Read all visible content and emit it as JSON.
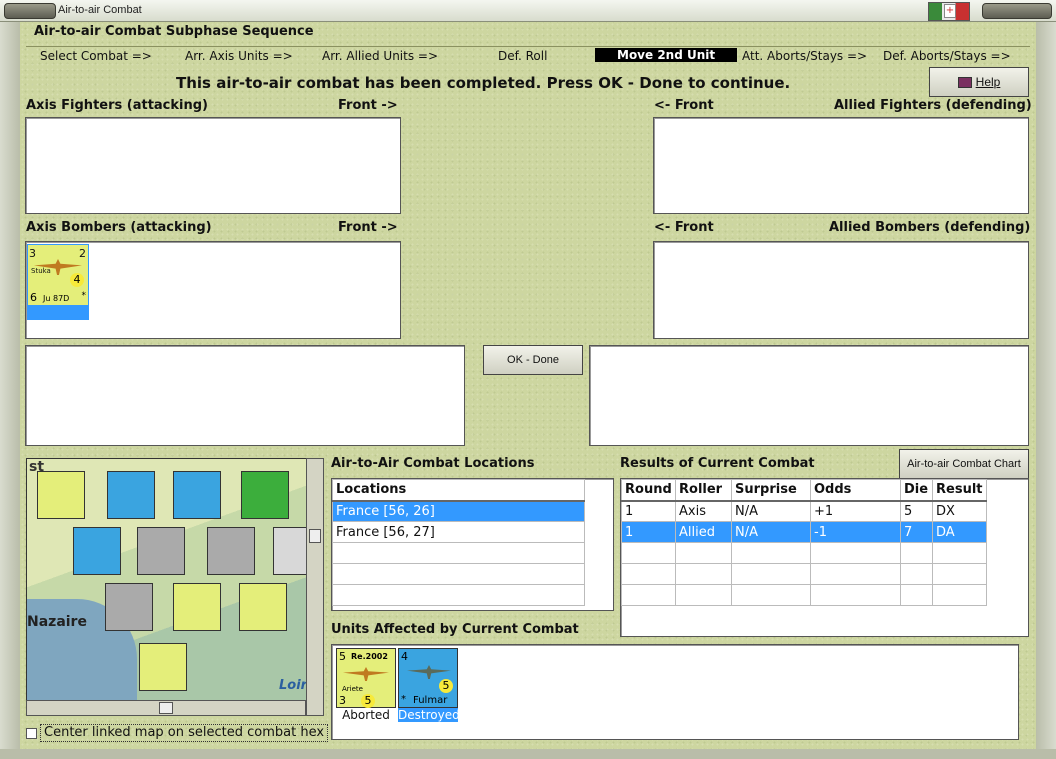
{
  "window": {
    "title": "Air-to-air Combat"
  },
  "subphase": {
    "title": "Air-to-air Combat Subphase Sequence",
    "steps": [
      "Select Combat =>",
      "Arr. Axis Units =>",
      "Arr. Allied Units =>",
      "Def. Roll",
      "Move 2nd Unit",
      "Att. Aborts/Stays =>",
      "Def. Aborts/Stays =>"
    ],
    "active_step": "Move 2nd Unit"
  },
  "message": "This air-to-air combat has been completed.  Press OK - Done to continue.",
  "help_label": "Help",
  "axis_fighters": {
    "label": "Axis Fighters (attacking)",
    "front": "Front ->"
  },
  "allied_fighters": {
    "label": "Allied Fighters (defending)",
    "front": "<- Front"
  },
  "axis_bombers": {
    "label": "Axis Bombers (attacking)",
    "front": "Front ->"
  },
  "allied_bombers": {
    "label": "Allied Bombers (defending)",
    "front": "<- Front"
  },
  "bomber_unit": {
    "top_left": "3",
    "top_right": "2",
    "name": "Stuka",
    "value": "4",
    "bottom_left": "6",
    "model": "Ju 87D",
    "star": "*"
  },
  "ok_label": "OK - Done",
  "combat_chart_label": "Air-to-air Combat Chart",
  "locations": {
    "title": "Air-to-Air Combat Locations",
    "header": "Locations",
    "rows": [
      "France [56, 26]",
      "France [56, 27]",
      "",
      "",
      "",
      ""
    ],
    "selected": 0
  },
  "results": {
    "title": "Results of Current Combat",
    "headers": [
      "Round",
      "Roller",
      "Surprise",
      "Odds",
      "Die",
      "Result"
    ],
    "rows": [
      [
        "1",
        "Axis",
        "N/A",
        "+1",
        "5",
        "DX"
      ],
      [
        "1",
        "Allied",
        "N/A",
        "-1",
        "7",
        "DA"
      ],
      [
        "",
        "",
        "",
        "",
        "",
        ""
      ],
      [
        "",
        "",
        "",
        "",
        "",
        ""
      ],
      [
        "",
        "",
        "",
        "",
        "",
        ""
      ],
      [
        "",
        "",
        "",
        "",
        "",
        ""
      ]
    ],
    "selected": 1
  },
  "affected": {
    "title": "Units Affected by Current Combat",
    "units": [
      {
        "model": "Re.2002",
        "name": "Ariete",
        "top": "5",
        "bottom_left": "3",
        "value": "5",
        "status": "Aborted"
      },
      {
        "model": "",
        "name": "Fulmar",
        "top": "4",
        "bottom_left": "*",
        "value": "5",
        "status": "Destroyed"
      }
    ]
  },
  "map": {
    "labels": [
      "st",
      "Nazaire",
      "Loir"
    ]
  },
  "center_checkbox": {
    "label": "Center linked map on selected combat hex",
    "checked": false
  },
  "colors": {
    "active_step_bg": "#000000",
    "selection": "#3399ff",
    "panel_bg": "#cdd6a0"
  }
}
